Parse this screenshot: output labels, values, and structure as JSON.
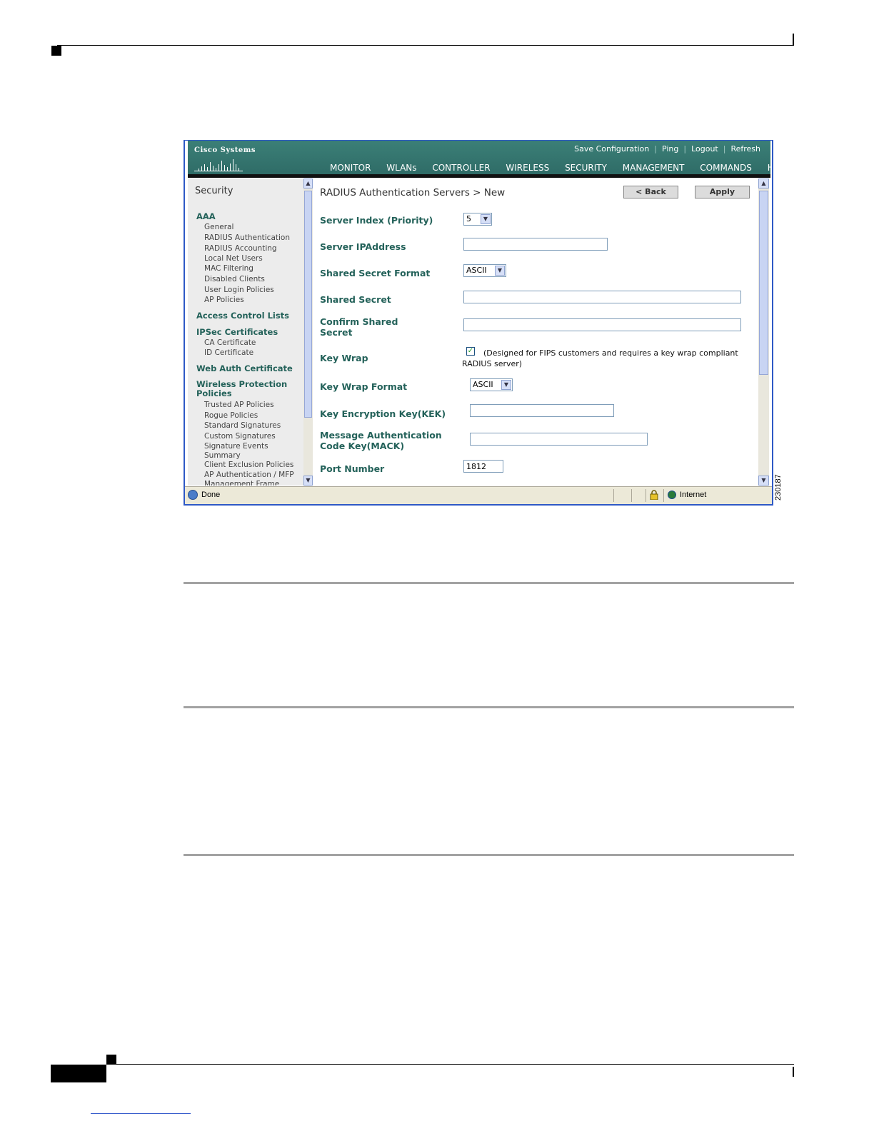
{
  "figure_id": "230187",
  "header": {
    "logo_text": "Cisco Systems",
    "links": [
      "Save Configuration",
      "Ping",
      "Logout",
      "Refresh"
    ],
    "nav": [
      "MONITOR",
      "WLANs",
      "CONTROLLER",
      "WIRELESS",
      "SECURITY",
      "MANAGEMENT",
      "COMMANDS",
      "HELP"
    ],
    "active_nav": "SECURITY"
  },
  "sidebar": {
    "title": "Security",
    "aaa": "AAA",
    "aaa_items": [
      "General",
      "RADIUS Authentication",
      "RADIUS Accounting",
      "Local Net Users",
      "MAC Filtering",
      "Disabled Clients",
      "User Login Policies",
      "AP Policies"
    ],
    "acl": "Access Control Lists",
    "ipsec": "IPSec Certificates",
    "ipsec_items": [
      "CA Certificate",
      "ID Certificate"
    ],
    "webauth": "Web Auth Certificate",
    "wps_line1": "Wireless Protection",
    "wps_line2": "Policies",
    "wps_items": [
      "Trusted AP Policies",
      "Rogue Policies",
      "Standard Signatures",
      "Custom Signatures",
      "Signature Events",
      "Summary",
      "Client Exclusion Policies",
      "AP Authentication / MFP",
      "Management Frame"
    ]
  },
  "main": {
    "title": "RADIUS Authentication Servers > New",
    "back_label": "< Back",
    "apply_label": "Apply",
    "fields": {
      "server_index_label": "Server Index (Priority)",
      "server_index_value": "5",
      "server_ip_label": "Server IPAddress",
      "server_ip_value": "",
      "secret_format_label": "Shared Secret Format",
      "secret_format_value": "ASCII",
      "secret_label": "Shared Secret",
      "secret_value": "",
      "confirm_label_1": "Confirm Shared",
      "confirm_label_2": "Secret",
      "confirm_value": "",
      "keywrap_label": "Key Wrap",
      "keywrap_checked": true,
      "keywrap_note_1": "(Designed for FIPS customers and requires a key wrap compliant",
      "keywrap_note_2": "RADIUS server)",
      "keywrap_format_label": "Key Wrap Format",
      "keywrap_format_value": "ASCII",
      "kek_label": "Key Encryption Key(KEK)",
      "kek_value": "",
      "mack_label_1": "Message Authentication",
      "mack_label_2": "Code Key(MACK)",
      "mack_value": "",
      "port_label": "Port Number",
      "port_value": "1812"
    }
  },
  "statusbar": {
    "status": "Done",
    "zone": "Internet"
  }
}
